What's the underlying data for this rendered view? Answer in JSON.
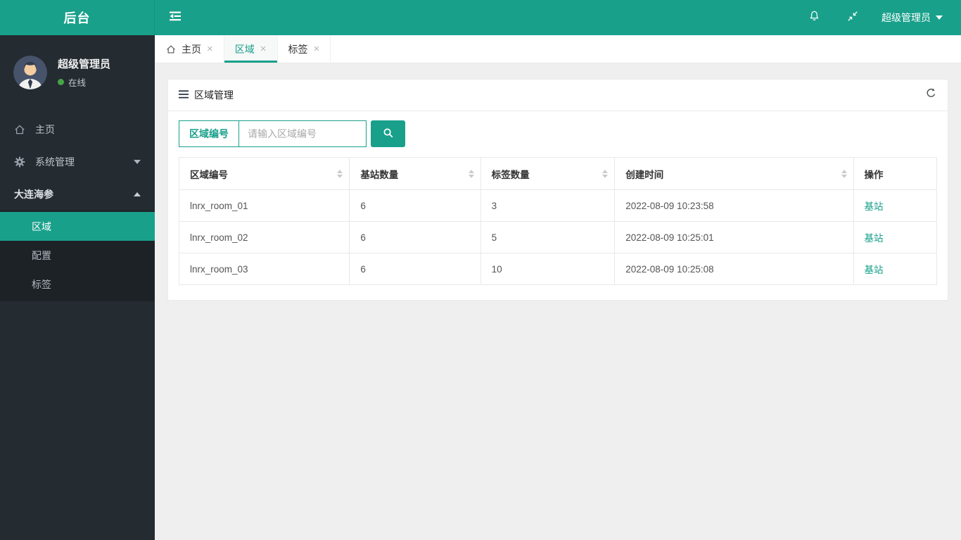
{
  "colors": {
    "primary": "#18a08b",
    "sidebar_bg": "#242b31",
    "submenu_bg": "#1d2227",
    "content_bg": "#efefef",
    "status_online": "#47a447"
  },
  "icons": {
    "close": "×",
    "list": [
      "outdent-icon",
      "bell-icon",
      "compress-icon",
      "caret-down-icon",
      "caret-up-icon",
      "home-icon",
      "gear-icon",
      "hamburger-icon",
      "refresh-icon",
      "search-icon",
      "online-dot",
      "avatar"
    ]
  },
  "header": {
    "logo": "后台",
    "user_label": "超级管理员"
  },
  "sidebar": {
    "user": {
      "name": "超级管理员",
      "status": "在线"
    },
    "menu": [
      {
        "label": "主页",
        "icon": "home-icon"
      },
      {
        "label": "系统管理",
        "icon": "gear-icon",
        "caret": "down"
      },
      {
        "label": "大连海参",
        "caret": "up"
      }
    ],
    "submenu": [
      {
        "label": "区域",
        "active": true
      },
      {
        "label": "配置",
        "active": false
      },
      {
        "label": "标签",
        "active": false
      }
    ]
  },
  "tabs": [
    {
      "label": "主页",
      "icon": "home-icon",
      "active": false
    },
    {
      "label": "区域",
      "active": true
    },
    {
      "label": "标签",
      "active": false
    }
  ],
  "panel": {
    "title": "区域管理",
    "search": {
      "label": "区域编号",
      "placeholder": "请输入区域编号"
    },
    "table": {
      "columns": [
        {
          "label": "区域编号",
          "sortable": true
        },
        {
          "label": "基站数量",
          "sortable": true
        },
        {
          "label": "标签数量",
          "sortable": true
        },
        {
          "label": "创建时间",
          "sortable": true
        },
        {
          "label": "操作",
          "sortable": false
        }
      ],
      "rows": [
        {
          "area": "lnrx_room_01",
          "stations": "6",
          "tags": "3",
          "created": "2022-08-09 10:23:58",
          "action": "基站"
        },
        {
          "area": "lnrx_room_02",
          "stations": "6",
          "tags": "5",
          "created": "2022-08-09 10:25:01",
          "action": "基站"
        },
        {
          "area": "lnrx_room_03",
          "stations": "6",
          "tags": "10",
          "created": "2022-08-09 10:25:08",
          "action": "基站"
        }
      ]
    }
  }
}
